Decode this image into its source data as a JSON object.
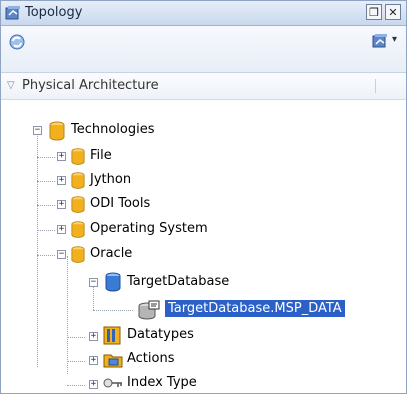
{
  "window": {
    "title": "Topology"
  },
  "section": {
    "label": "Physical Architecture"
  },
  "tree": {
    "root": "Technologies",
    "file": "File",
    "jython": "Jython",
    "odi_tools": "ODI Tools",
    "operating_system": "Operating System",
    "oracle": "Oracle",
    "target_database": "TargetDatabase",
    "target_schema": "TargetDatabase.MSP_DATA",
    "datatypes": "Datatypes",
    "actions": "Actions",
    "index_type": "Index Type"
  },
  "icons": {
    "window": "topology-icon",
    "restore": "restore-icon",
    "close": "close-icon",
    "refresh": "refresh-icon",
    "connect": "connect-menu-icon"
  },
  "colors": {
    "selection": "#2a60c8",
    "folder": "#f2b01e",
    "database": "#3a7bd5"
  }
}
